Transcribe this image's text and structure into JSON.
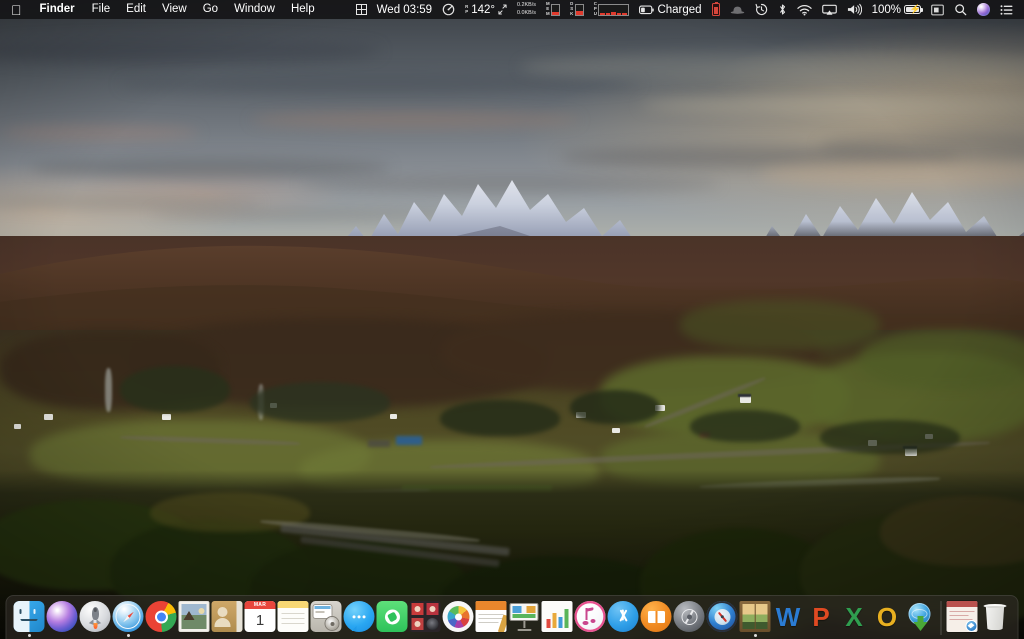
{
  "menubar": {
    "apple_logo": "",
    "app_menus": [
      {
        "label": "Finder",
        "bold": true,
        "name": "menu-finder"
      },
      {
        "label": "File",
        "bold": false,
        "name": "menu-file"
      },
      {
        "label": "Edit",
        "bold": false,
        "name": "menu-edit"
      },
      {
        "label": "View",
        "bold": false,
        "name": "menu-view"
      },
      {
        "label": "Go",
        "bold": false,
        "name": "menu-go"
      },
      {
        "label": "Window",
        "bold": false,
        "name": "menu-window"
      },
      {
        "label": "Help",
        "bold": false,
        "name": "menu-help"
      }
    ],
    "status": {
      "window_grid_icon": "grid-icon",
      "clock": "Wed 03:59",
      "speedometer_icon": "speedometer-icon",
      "fan_label_top": "R",
      "fan_label_bottom": "P",
      "temperature": "142°",
      "expand_icon": "expand-arrows-icon",
      "net_down": "0.2KB/s",
      "net_up": "0.0KB/s",
      "mem_label_top": "M",
      "mem_label_mid": "E",
      "mem_label_bottom": "M",
      "disk_label_top": "D",
      "disk_label_mid": "S",
      "disk_label_bottom": "K",
      "cpu_label_top": "C",
      "cpu_label_mid": "P",
      "cpu_label_bottom": "U",
      "charged_label": "Charged",
      "battery_percent": "100%",
      "bartender_icon": "bowler-hat-icon",
      "timemachine_icon": "clock-arrow-icon",
      "bluetooth_icon": "bluetooth-icon",
      "wifi_icon": "wifi-icon",
      "airplay_icon": "airplay-icon",
      "volume_icon": "volume-icon",
      "screenshot_icon": "screenshot-icon",
      "spotlight_icon": "search-icon",
      "siri_icon": "siri-icon",
      "controlcenter_icon": "control-center-icon",
      "red_battery_icon": "low-battery-red-icon"
    }
  },
  "dock": {
    "items": [
      {
        "name": "dock-finder",
        "label": "Finder",
        "running": true
      },
      {
        "name": "dock-siri",
        "label": "Siri",
        "running": false
      },
      {
        "name": "dock-launchpad",
        "label": "Launchpad",
        "running": false
      },
      {
        "name": "dock-safari",
        "label": "Safari",
        "running": true
      },
      {
        "name": "dock-chrome",
        "label": "Google Chrome",
        "running": false
      },
      {
        "name": "dock-preview",
        "label": "Preview",
        "running": false
      },
      {
        "name": "dock-contacts",
        "label": "Contacts",
        "running": false
      },
      {
        "name": "dock-calendar",
        "label": "Calendar",
        "running": false
      },
      {
        "name": "dock-notes",
        "label": "Notes",
        "running": false
      },
      {
        "name": "dock-system-preferences",
        "label": "System Preferences",
        "running": false
      },
      {
        "name": "dock-messages",
        "label": "Messages",
        "running": false
      },
      {
        "name": "dock-facetime",
        "label": "FaceTime",
        "running": false
      },
      {
        "name": "dock-photo-booth",
        "label": "Photo Booth",
        "running": false
      },
      {
        "name": "dock-photos",
        "label": "Photos",
        "running": false
      },
      {
        "name": "dock-pages",
        "label": "Pages",
        "running": false
      },
      {
        "name": "dock-keynote",
        "label": "Keynote",
        "running": false
      },
      {
        "name": "dock-numbers",
        "label": "Numbers",
        "running": false
      },
      {
        "name": "dock-itunes",
        "label": "iTunes",
        "running": false
      },
      {
        "name": "dock-app-store",
        "label": "App Store",
        "running": false
      },
      {
        "name": "dock-ibooks",
        "label": "iBooks",
        "running": false
      },
      {
        "name": "dock-xcode",
        "label": "Xcode",
        "running": false
      },
      {
        "name": "dock-activity-monitor",
        "label": "Activity Monitor",
        "running": false
      },
      {
        "name": "dock-desktop-app",
        "label": "Desktop",
        "running": true
      },
      {
        "name": "dock-word",
        "label": "Microsoft Word",
        "running": false
      },
      {
        "name": "dock-powerpoint",
        "label": "Microsoft PowerPoint",
        "running": false
      },
      {
        "name": "dock-excel",
        "label": "Microsoft Excel",
        "running": false
      },
      {
        "name": "dock-outlook",
        "label": "Microsoft Outlook",
        "running": false
      },
      {
        "name": "dock-downloader",
        "label": "Downloader",
        "running": false
      }
    ],
    "calendar_month": "MAR",
    "calendar_day": "1",
    "word_letter": "W",
    "powerpoint_letter": "P",
    "excel_letter": "X",
    "outlook_letter": "O",
    "stack_name": "downloads-stack",
    "trash_name": "trash"
  },
  "desktop": {
    "wallpaper_name": "skye-cuillin-mountains-wallpaper",
    "wallpaper_description": "Snow-capped mountain range at dusk over a green glen with scattered white cottages"
  }
}
